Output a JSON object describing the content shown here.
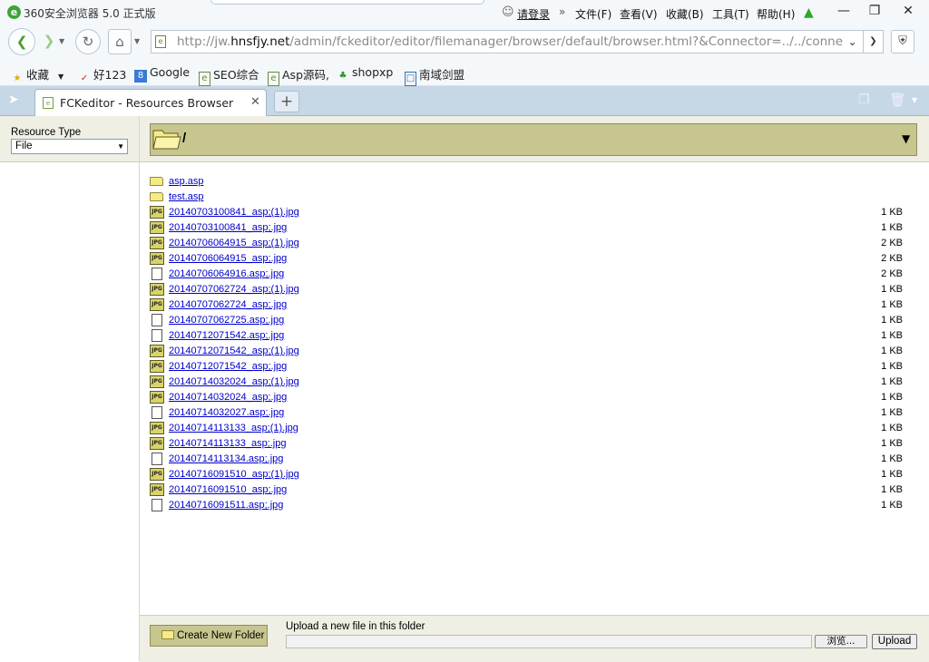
{
  "window": {
    "title": "360安全浏览器 5.0 正式版",
    "login": "请登录",
    "menus": [
      "文件(F)",
      "查看(V)",
      "收藏(B)",
      "工具(T)",
      "帮助(H)"
    ]
  },
  "nav": {
    "address_prefix": "http://jw.",
    "address_host": "hnsfjy.net",
    "address_rest": "/admin/fckeditor/editor/filemanager/browser/default/browser.html?&Connector=../../connectors/asp/connector.asp"
  },
  "bookmarks": [
    "收藏",
    "好123",
    "Google",
    "SEO综合",
    "Asp源码,",
    "shopxp",
    "南域剑盟"
  ],
  "tab": {
    "title": "FCKeditor - Resources Browser"
  },
  "fck": {
    "resource_type_label": "Resource Type",
    "resource_type_value": "File",
    "current_folder": "/",
    "files": [
      {
        "type": "folder",
        "name": "asp.asp",
        "size": ""
      },
      {
        "type": "folder",
        "name": "test.asp",
        "size": ""
      },
      {
        "type": "jpg",
        "name": "20140703100841_asp;(1).jpg",
        "size": "1 KB"
      },
      {
        "type": "jpg",
        "name": "20140703100841_asp;.jpg",
        "size": "1 KB"
      },
      {
        "type": "jpg",
        "name": "20140706064915_asp;(1).jpg",
        "size": "2 KB"
      },
      {
        "type": "jpg",
        "name": "20140706064915_asp;.jpg",
        "size": "2 KB"
      },
      {
        "type": "file",
        "name": "20140706064916.asp;.jpg",
        "size": "2 KB"
      },
      {
        "type": "jpg",
        "name": "20140707062724_asp;(1).jpg",
        "size": "1 KB"
      },
      {
        "type": "jpg",
        "name": "20140707062724_asp;.jpg",
        "size": "1 KB"
      },
      {
        "type": "file",
        "name": "20140707062725.asp;.jpg",
        "size": "1 KB"
      },
      {
        "type": "file",
        "name": "20140712071542.asp;.jpg",
        "size": "1 KB"
      },
      {
        "type": "jpg",
        "name": "20140712071542_asp;(1).jpg",
        "size": "1 KB"
      },
      {
        "type": "jpg",
        "name": "20140712071542_asp;.jpg",
        "size": "1 KB"
      },
      {
        "type": "jpg",
        "name": "20140714032024_asp;(1).jpg",
        "size": "1 KB"
      },
      {
        "type": "jpg",
        "name": "20140714032024_asp;.jpg",
        "size": "1 KB"
      },
      {
        "type": "file",
        "name": "20140714032027.asp;.jpg",
        "size": "1 KB"
      },
      {
        "type": "jpg",
        "name": "20140714113133_asp;(1).jpg",
        "size": "1 KB"
      },
      {
        "type": "jpg",
        "name": "20140714113133_asp;.jpg",
        "size": "1 KB"
      },
      {
        "type": "file",
        "name": "20140714113134.asp;.jpg",
        "size": "1 KB"
      },
      {
        "type": "jpg",
        "name": "20140716091510_asp;(1).jpg",
        "size": "1 KB"
      },
      {
        "type": "jpg",
        "name": "20140716091510_asp;.jpg",
        "size": "1 KB"
      },
      {
        "type": "file",
        "name": "20140716091511.asp;.jpg",
        "size": "1 KB"
      }
    ],
    "create_folder_label": "Create New Folder",
    "upload_label": "Upload a new file in this folder",
    "browse_label": "浏览...",
    "upload_button": "Upload"
  },
  "icons": {
    "jpg_badge": "JPG"
  }
}
